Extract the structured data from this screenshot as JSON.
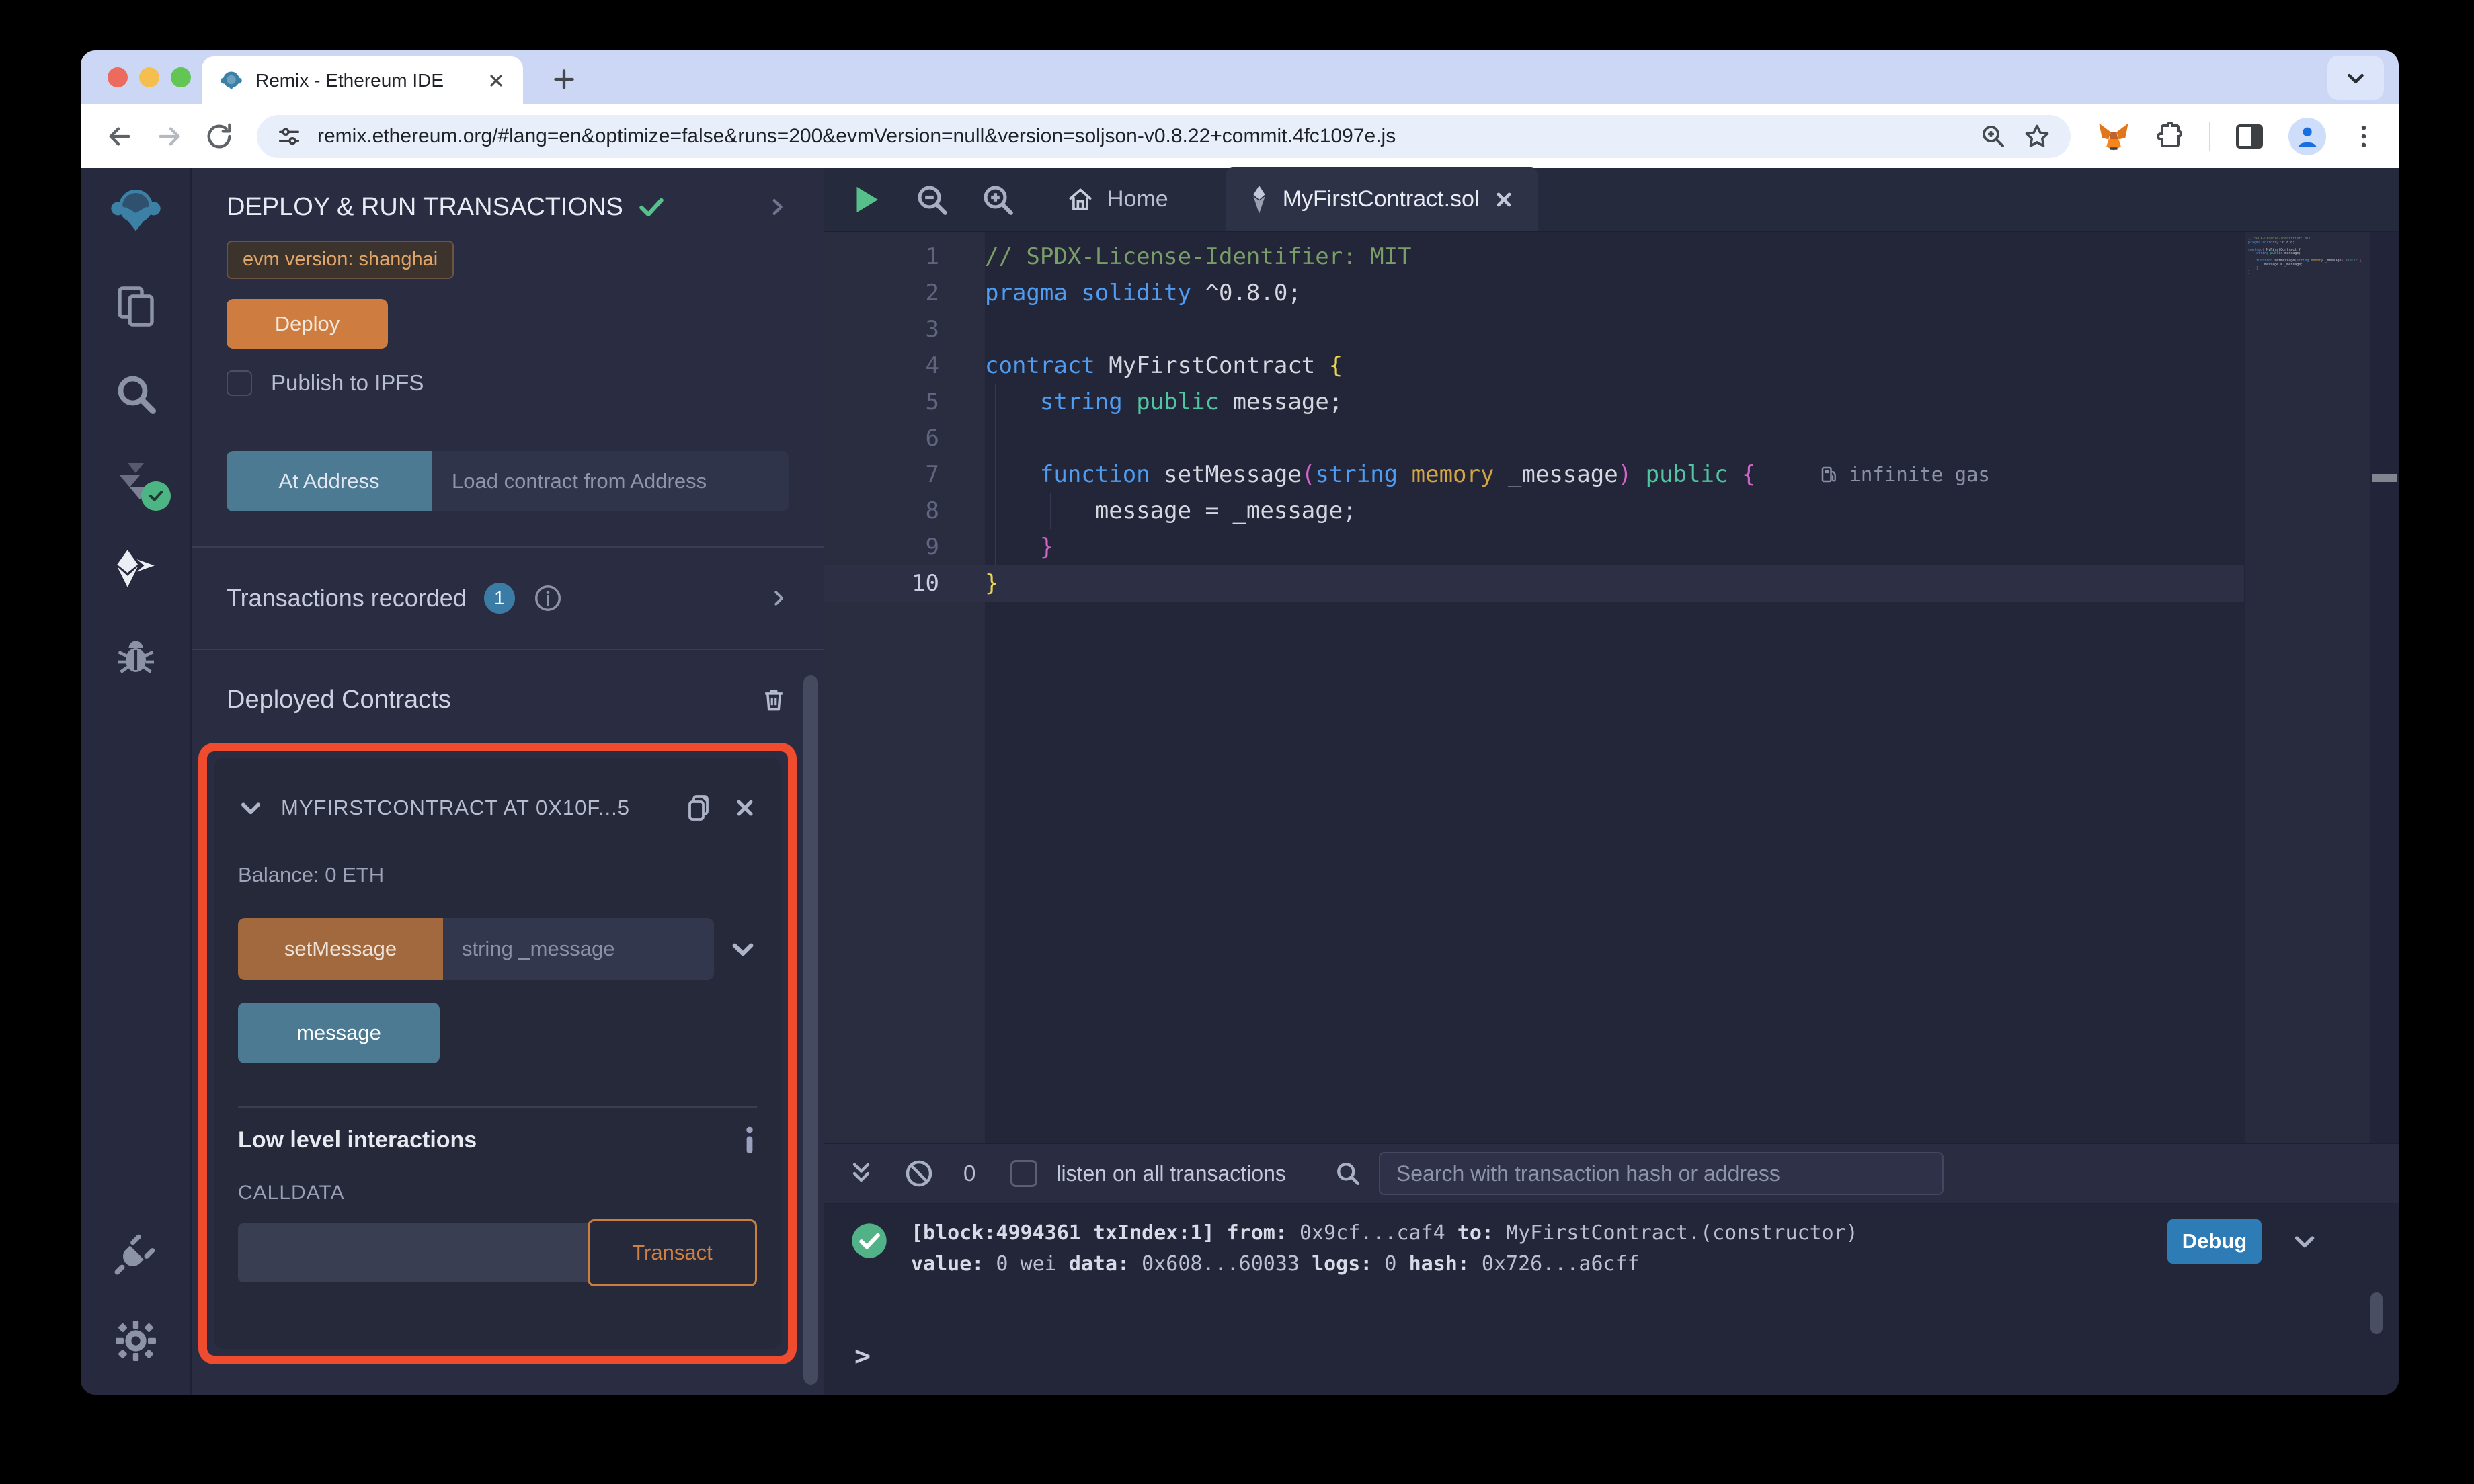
{
  "chrome": {
    "tab_title": "Remix - Ethereum IDE",
    "url": "remix.ethereum.org/#lang=en&optimize=false&runs=200&evmVersion=null&version=soljson-v0.8.22+commit.4fc1097e.js"
  },
  "panel": {
    "title": "DEPLOY & RUN TRANSACTIONS",
    "evm_badge": "evm version: shanghai",
    "deploy": "Deploy",
    "publish_ipfs": "Publish to IPFS",
    "at_address": "At Address",
    "at_address_placeholder": "Load contract from Address",
    "tx_recorded": "Transactions recorded",
    "tx_count": "1",
    "deployed_title": "Deployed Contracts",
    "contract": {
      "header": "MYFIRSTCONTRACT AT 0X10F...5",
      "balance": "Balance: 0 ETH",
      "fn_write": "setMessage",
      "fn_write_placeholder": "string _message",
      "fn_read": "message",
      "low_level": "Low level interactions",
      "calldata": "CALLDATA",
      "transact": "Transact"
    }
  },
  "editor": {
    "home_tab": "Home",
    "file_tab": "MyFirstContract.sol",
    "gas_label": "infinite gas",
    "lines": [
      {
        "n": "1",
        "tokens": [
          {
            "t": "// SPDX-License-Identifier: MIT",
            "c": "comment"
          }
        ]
      },
      {
        "n": "2",
        "tokens": [
          {
            "t": "pragma solidity",
            "c": "kw"
          },
          {
            "t": " ^0.8.0;",
            "c": "plain"
          }
        ]
      },
      {
        "n": "3",
        "tokens": []
      },
      {
        "n": "4",
        "tokens": [
          {
            "t": "contract",
            "c": "kw"
          },
          {
            "t": " MyFirstContract ",
            "c": "plain"
          },
          {
            "t": "{",
            "c": "b1"
          }
        ]
      },
      {
        "n": "5",
        "tokens": [
          {
            "t": "    ",
            "c": "plain"
          },
          {
            "t": "string",
            "c": "kw"
          },
          {
            "t": " ",
            "c": "plain"
          },
          {
            "t": "public",
            "c": "type"
          },
          {
            "t": " message;",
            "c": "plain"
          }
        ],
        "guides": [
          255
        ]
      },
      {
        "n": "6",
        "tokens": [],
        "guides": [
          255
        ]
      },
      {
        "n": "7",
        "tokens": [
          {
            "t": "    ",
            "c": "plain"
          },
          {
            "t": "function",
            "c": "kw"
          },
          {
            "t": " setMessage",
            "c": "plain"
          },
          {
            "t": "(",
            "c": "b2"
          },
          {
            "t": "string",
            "c": "kw"
          },
          {
            "t": " ",
            "c": "plain"
          },
          {
            "t": "memory",
            "c": "gold"
          },
          {
            "t": " _message",
            "c": "plain"
          },
          {
            "t": ")",
            "c": "b2"
          },
          {
            "t": " ",
            "c": "plain"
          },
          {
            "t": "public",
            "c": "type"
          },
          {
            "t": " ",
            "c": "plain"
          },
          {
            "t": "{",
            "c": "b2"
          }
        ],
        "gas": true,
        "guides": [
          255
        ]
      },
      {
        "n": "8",
        "tokens": [
          {
            "t": "        message = _message;",
            "c": "plain"
          }
        ],
        "guides": [
          255,
          337
        ]
      },
      {
        "n": "9",
        "tokens": [
          {
            "t": "    ",
            "c": "plain"
          },
          {
            "t": "}",
            "c": "b2"
          }
        ],
        "guides": [
          255
        ]
      },
      {
        "n": "10",
        "tokens": [
          {
            "t": "}",
            "c": "b1"
          }
        ],
        "active": true
      }
    ]
  },
  "terminal": {
    "count": "0",
    "listen": "listen on all transactions",
    "search_placeholder": "Search with transaction hash or address",
    "debug": "Debug",
    "prompt": ">",
    "log1": [
      {
        "t": "[block:4994361 txIndex:1] ",
        "b": true
      },
      {
        "t": "from:",
        "b": true
      },
      {
        "t": " 0x9cf...caf4 ",
        "b": false
      },
      {
        "t": "to:",
        "b": true
      },
      {
        "t": " MyFirstContract.(constructor)",
        "b": false
      }
    ],
    "log2": [
      {
        "t": "value:",
        "b": true
      },
      {
        "t": " 0 wei ",
        "b": false
      },
      {
        "t": "data:",
        "b": true
      },
      {
        "t": " 0x608...60033 ",
        "b": false
      },
      {
        "t": "logs:",
        "b": true
      },
      {
        "t": " 0 ",
        "b": false
      },
      {
        "t": "hash:",
        "b": true
      },
      {
        "t": " 0x726...a6cff",
        "b": false
      }
    ]
  },
  "colors": {
    "accent_orange": "#ce7c3f",
    "teal": "#4b7a92",
    "debug_blue": "#2d7cb5",
    "highlight_red": "#ef4b2f",
    "success_green": "#58c08c"
  }
}
